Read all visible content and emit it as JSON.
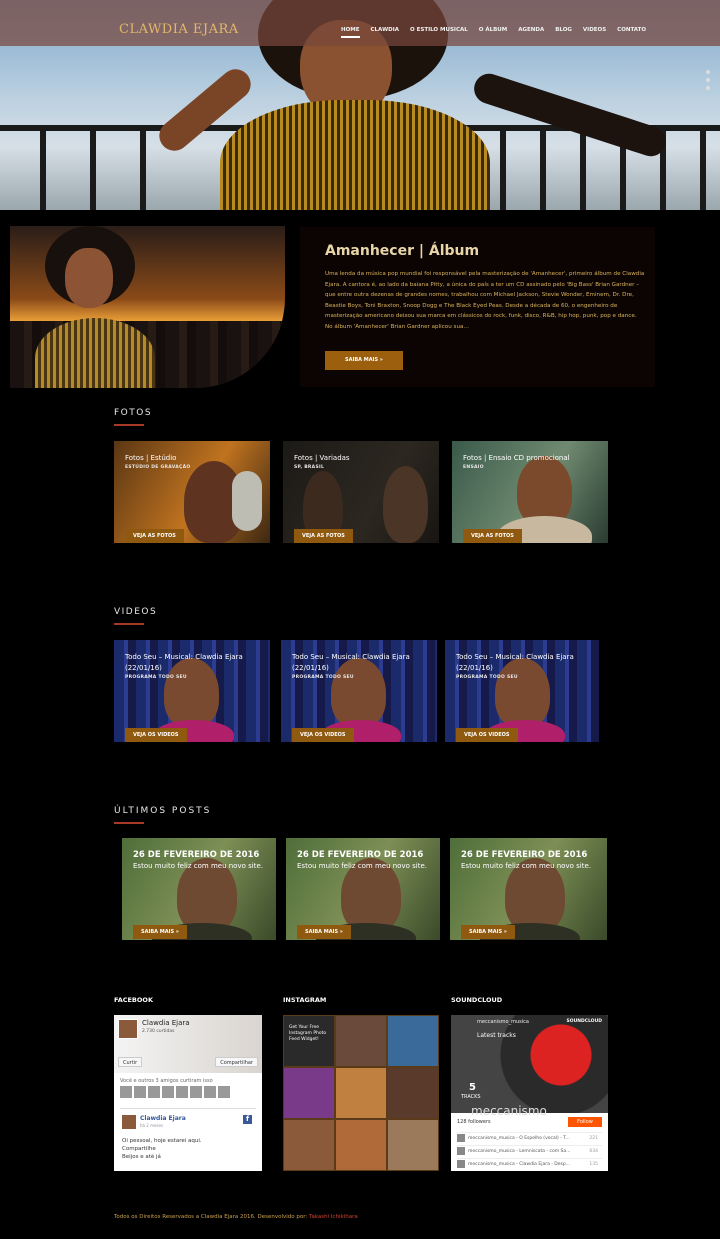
{
  "nav": {
    "logo": "CLAWDIA EJARA",
    "items": [
      "HOME",
      "CLAWDIA",
      "O ESTILO MUSICAL",
      "O ÁLBUM",
      "AGENDA",
      "BLOG",
      "VIDEOS",
      "CONTATO"
    ]
  },
  "album": {
    "title": "Amanhecer | Álbum",
    "text": "Uma lenda da música pop mundial foi responsável pela masterização de 'Amanhecer', primeiro álbum de Clawdia Ejara. A cantora é, ao lado da baiana Pitty, a única do país a ter um CD assinado pelo 'Big Bass' Brian Gardner – que entre outra dezenas de grandes nomes, trabalhou com Michael Jackson, Stevie Wonder, Eminem, Dr. Dre, Beastie Boys, Toni Braxton, Snoop Dogg e The Black Eyed Peas. Desde a década de 60, o engenheiro de masterização americano deixou sua marca em clássicos do rock, funk, disco, R&B, hip hop, punk, pop e dance. No álbum 'Amanhecer' Brian Gardner aplicou sua…",
    "button": "SAIBA MAIS »"
  },
  "fotos": {
    "title": "FOTOS",
    "cards": [
      {
        "title": "Fotos | Estúdio",
        "sub": "ESTÚDIO DE GRAVAÇÃO",
        "button": "VEJA AS FOTOS"
      },
      {
        "title": "Fotos | Variadas",
        "sub": "SP, BRASIL",
        "button": "VEJA AS FOTOS"
      },
      {
        "title": "Fotos | Ensaio CD promocional",
        "sub": "ENSAIO",
        "button": "VEJA AS FOTOS"
      }
    ]
  },
  "videos": {
    "title": "VIDEOS",
    "cards": [
      {
        "title": "Todo Seu – Musical: Clawdia Ejara",
        "date": "(22/01/16)",
        "sub": "PROGRAMA TODO SEU",
        "button": "VEJA OS VIDEOS"
      },
      {
        "title": "Todo Seu – Musical: Clawdia Ejara",
        "date": "(22/01/16)",
        "sub": "PROGRAMA TODO SEU",
        "button": "VEJA OS VIDEOS"
      },
      {
        "title": "Todo Seu – Musical: Clawdia Ejara",
        "date": "(22/01/16)",
        "sub": "PROGRAMA TODO SEU",
        "button": "VEJA OS VIDEOS"
      }
    ]
  },
  "posts": {
    "title": "ÚLTIMOS POSTS",
    "cards": [
      {
        "title": "26 DE FEVEREIRO DE 2016",
        "sub": "Estou muito feliz com meu novo site.",
        "button": "SAIBA MAIS »"
      },
      {
        "title": "26 DE FEVEREIRO DE 2016",
        "sub": "Estou muito feliz com meu novo site.",
        "button": "SAIBA MAIS »"
      },
      {
        "title": "26 DE FEVEREIRO DE 2016",
        "sub": "Estou muito feliz com meu novo site.",
        "button": "SAIBA MAIS »"
      }
    ]
  },
  "facebook": {
    "title": "FACEBOOK",
    "page_name": "Clawdia Ejara",
    "likes": "2.730 curtidas",
    "like_btn": "Curtir",
    "share_btn": "Compartilhar",
    "friends": "Você e outros 3 amigos curtiram isso",
    "post_name": "Clawdia Ejara",
    "post_time": "há 2 meses",
    "post_msg": [
      "Oi pessoal, hoje estarei aqui.",
      "Compartilhe",
      "Beijos e até já"
    ]
  },
  "instagram": {
    "title": "INSTAGRAM",
    "caption": "Get Your Free Instagram Photo Feed Widget!"
  },
  "soundcloud": {
    "title": "SOUNDCLOUD",
    "user": "meccanismo_musica",
    "latest": "Latest tracks",
    "brand": "SOUNDCLOUD",
    "tracks_count": "5",
    "tracks_label": "TRACKS",
    "big": "meccanismo",
    "followers": "128 followers",
    "follow": "Follow",
    "tracks": [
      {
        "name": "meccanismo_musica - O Espelho (vocal) - T...",
        "count": "221"
      },
      {
        "name": "meccanismo_musica - Lemniscata - com Sa...",
        "count": "634"
      },
      {
        "name": "meccanismo_musica - Clawdia Ejara - Desp...",
        "count": "135"
      }
    ]
  },
  "footer": {
    "text": "Todos os Direitos Reservados a Clawdia Ejara 2016. Desenvolvido por: ",
    "author": "Takashi Ichikihara"
  }
}
